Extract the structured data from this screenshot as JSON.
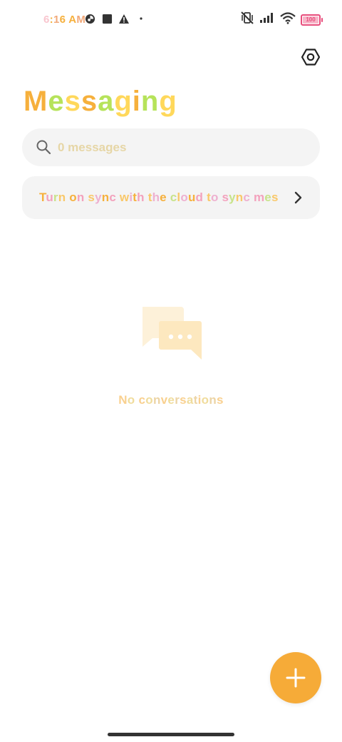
{
  "status_bar": {
    "time": "6:16 AM",
    "battery_level": "100",
    "icons_left": [
      "data-saver-icon",
      "square-notification-icon",
      "warning-icon",
      "dot-icon"
    ],
    "icons_right": [
      "vibrate-off-icon",
      "signal-icon",
      "wifi-icon",
      "battery-icon"
    ]
  },
  "header": {
    "title": "Messaging",
    "settings_icon": "settings-hexagon-icon"
  },
  "search": {
    "placeholder": "0 messages"
  },
  "sync_banner": {
    "text": "Turn on sync with the cloud to sync messages"
  },
  "empty_state": {
    "icon": "chat-bubbles-icon",
    "text": "No conversations"
  },
  "fab": {
    "icon": "plus-icon",
    "color": "#f6ab38"
  },
  "colors": {
    "accent": "#f6ab38",
    "green": "#b6e35a",
    "yellow": "#ffd85b",
    "pink": "#f3a2bd"
  }
}
